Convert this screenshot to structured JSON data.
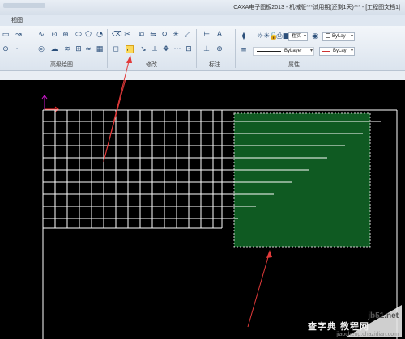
{
  "window": {
    "title": "CAXA电子图板2013 - 机械版***试用期(还剩1天)*** - [工程图文档1]"
  },
  "menu": {
    "tab_view": "视图"
  },
  "ribbon": {
    "group_advanced_draw": "高级绘图",
    "group_modify": "修改",
    "group_annotate": "标注",
    "group_properties": "属性",
    "thickness_label": "粗实",
    "color_select": "ByLay",
    "linetype_select": "ByLayer",
    "lineweight_select": "ByLay"
  },
  "colors": {
    "grid_line": "#ffffff",
    "selection_fill": "#0f5a22",
    "axis_x": "#ff2a2a",
    "axis_y": "#d21ad2",
    "annotation_arrow": "#e23a3a",
    "highlight_tool": "#fbd95a"
  },
  "watermark": {
    "site": "jb51.net",
    "brand": "查字典 教程网",
    "url": "jiaocheng.chazidian.com"
  }
}
